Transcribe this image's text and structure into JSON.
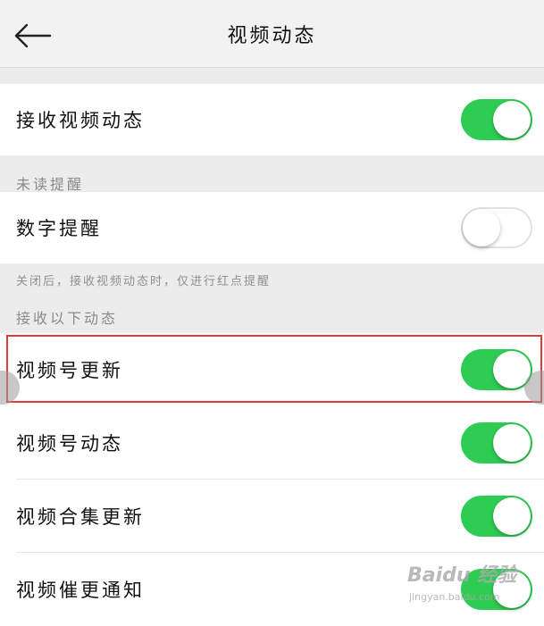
{
  "header": {
    "title": "视频动态",
    "back_icon": "arrow-left-icon"
  },
  "settings": {
    "receive_video": {
      "label": "接收视频动态",
      "enabled": true
    },
    "unread_section": "未读提醒",
    "number_reminder": {
      "label": "数字提醒",
      "enabled": false
    },
    "number_reminder_hint": "关闭后，接收视频动态时，仅进行红点提醒",
    "receive_section": "接收以下动态",
    "items": [
      {
        "label": "视频号更新",
        "enabled": true
      },
      {
        "label": "视频号动态",
        "enabled": true
      },
      {
        "label": "视频合集更新",
        "enabled": true
      },
      {
        "label": "视频催更通知",
        "enabled": true
      }
    ]
  },
  "colors": {
    "toggle_on": "#2ecc52",
    "highlight": "#e23b3b"
  },
  "watermark": {
    "logo": "Baidu 经验",
    "sub": "jingyan.baidu.com"
  }
}
